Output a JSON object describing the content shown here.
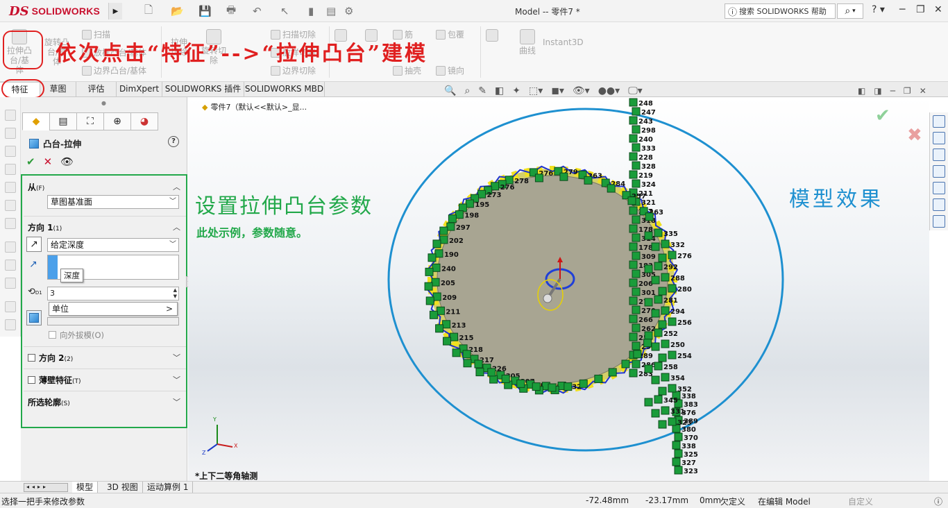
{
  "app": {
    "brand_ds": "DS",
    "brand_name": "SOLIDWORKS",
    "doc_title": "Model -- 零件7 *"
  },
  "help_search": {
    "placeholder": "搜索 SOLIDWORKS 帮助"
  },
  "ribbon": {
    "extrude_boss": "拉伸凸台/基体",
    "revolve_boss": "旋转凸台/基体",
    "sweep": "扫描",
    "loft": "放样凸台/基体",
    "boundary_boss": "边界凸台/基体",
    "extrude_cut": "拉伸切除",
    "revolve_cut": "旋转切除",
    "sweep_cut": "扫描切除",
    "loft_cut": "放样切割",
    "boundary_cut": "边界切除",
    "rib": "筋",
    "wrap": "包覆",
    "shell": "抽壳",
    "mirror": "镜向",
    "curves": "曲线",
    "instant3d": "Instant3D"
  },
  "annotations": {
    "red_instruction": "依次点击“特征”-->“拉伸凸台”建模",
    "set_params": "设置拉伸凸台参数",
    "sample_note": "此处示例，参数随意。",
    "model_effect": "模型效果"
  },
  "tabs": [
    "特征",
    "草图",
    "评估",
    "DimXpert",
    "SOLIDWORKS 插件",
    "SOLIDWORKS MBD"
  ],
  "tree": {
    "root": "零件7（默认<<默认>_显..."
  },
  "pm": {
    "title": "凸台-拉伸",
    "from_label": "从",
    "from_key": "(F)",
    "from_value": "草图基准面",
    "dir1_label": "方向 1",
    "dir1_key": "(1)",
    "end_condition": "给定深度",
    "depth_tooltip": "深度",
    "depth_value": "3",
    "unit_menu": "单位",
    "unit_arrow": ">",
    "draft_outward": "向外拔模(O)",
    "dir2_label": "方向 2",
    "dir2_key": "(2)",
    "thin_label": "薄壁特征",
    "thin_key": "(T)",
    "selected_contours": "所选轮廓",
    "selected_key": "(S)",
    "dim_badge": "D1"
  },
  "viewport": {
    "view_label": "*上下二等角轴测",
    "triad": {
      "x": "X",
      "y": "Y",
      "z": "Z"
    }
  },
  "bottom_tabs": [
    "模型",
    "3D 视图",
    "运动算例 1"
  ],
  "status": {
    "hint": "选择一把手来修改参数",
    "x": "-72.48mm",
    "y": "-23.17mm",
    "z": "0mm",
    "define": "欠定义",
    "editing": "在编辑 Model",
    "custom": "自定义"
  },
  "colors": {
    "accent_red": "#e02020",
    "note_green": "#22a84a",
    "effect_blue": "#1e90d0",
    "badge_green": "#1a9c3a"
  },
  "label_numbers": {
    "top_stack": [
      "248",
      "247",
      "243",
      "298",
      "240",
      "333",
      "228",
      "328",
      "219",
      "324",
      "211",
      "321",
      "217",
      "318",
      "178",
      "314",
      "178",
      "309",
      "183",
      "305",
      "206",
      "301",
      "273",
      "270",
      "266",
      "262",
      "259",
      "293",
      "289",
      "286",
      "283"
    ],
    "bottom_stack": [
      "338",
      "383",
      "376",
      "389",
      "380",
      "370",
      "338",
      "325",
      "327",
      "323"
    ],
    "left_ring": [
      "278",
      "276",
      "273",
      "195",
      "198",
      "297",
      "202",
      "190",
      "240",
      "205",
      "209",
      "211",
      "213",
      "215",
      "218",
      "217",
      "226",
      "305",
      "307",
      "308",
      "229",
      "232"
    ],
    "top_ring": [
      "276",
      "279",
      "263",
      "284",
      "257",
      "263"
    ],
    "right_ring": [
      "335",
      "332",
      "276",
      "292",
      "288",
      "280",
      "281",
      "294",
      "256",
      "252",
      "250",
      "254",
      "258",
      "354",
      "352",
      "345",
      "331",
      "323"
    ]
  }
}
